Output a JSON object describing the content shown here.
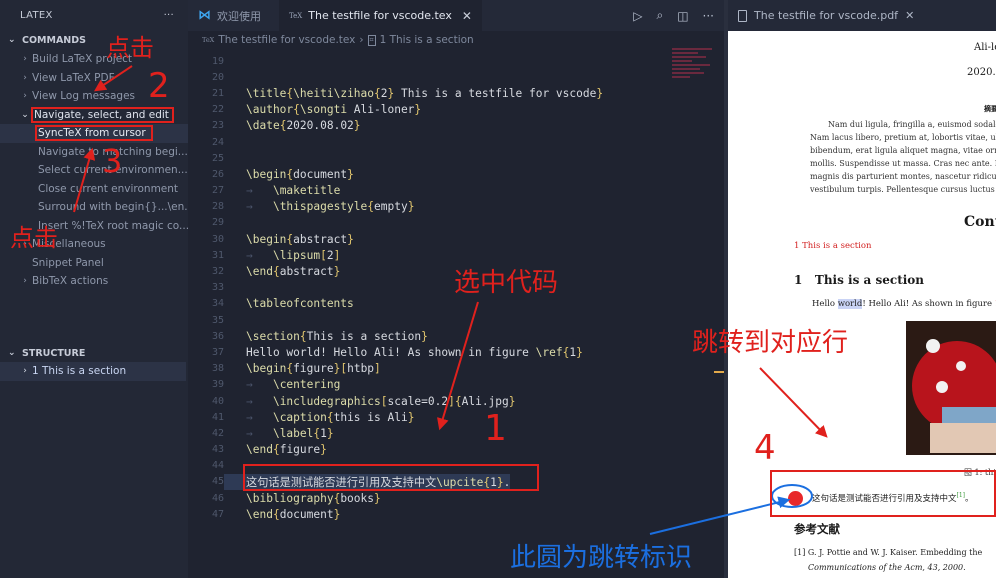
{
  "sidebar": {
    "title": "LATEX",
    "more": "···",
    "commands_header": "COMMANDS",
    "items": [
      {
        "label": "Build LaTeX project",
        "chev": "›"
      },
      {
        "label": "View LaTeX PDF",
        "chev": "›"
      },
      {
        "label": "View Log messages",
        "chev": "›"
      },
      {
        "label": "Navigate, select, and edit",
        "chev": "⌄"
      }
    ],
    "sub_items": [
      "SyncTeX from cursor",
      "Navigate to matching begi...",
      "Select current environmen...",
      "Close current environment",
      "Surround with begin{}...\\en...",
      "Insert %!TeX root magic co..."
    ],
    "leaf_items": [
      {
        "label": "Miscellaneous",
        "chev": "›"
      },
      {
        "label": "Snippet Panel",
        "chev": ""
      },
      {
        "label": "BibTeX actions",
        "chev": "›"
      }
    ],
    "structure_header": "STRUCTURE",
    "structure_item": "1 This is a section"
  },
  "editor": {
    "tabs": [
      {
        "label": "欢迎使用",
        "icon": "vscode-icon"
      },
      {
        "label": "The testfile for vscode.tex",
        "icon": "tex-icon"
      }
    ],
    "close": "✕",
    "breadcrumb": {
      "tex": "TeX",
      "file": "The testfile for vscode.tex",
      "sep": "›",
      "section": "1 This is a section"
    },
    "lines": [
      {
        "n": "19",
        "text": ""
      },
      {
        "n": "20",
        "text": ""
      },
      {
        "n": "21",
        "text": "\\title{\\heiti\\zihao{2} This is a testfile for vscode}"
      },
      {
        "n": "22",
        "text": "\\author{\\songti Ali-loner}"
      },
      {
        "n": "23",
        "text": "\\date{2020.08.02}"
      },
      {
        "n": "24",
        "text": ""
      },
      {
        "n": "25",
        "text": ""
      },
      {
        "n": "26",
        "text": "\\begin{document}"
      },
      {
        "n": "27",
        "text": "\\maketitle",
        "indent": true
      },
      {
        "n": "28",
        "text": "\\thispagestyle{empty}",
        "indent": true
      },
      {
        "n": "29",
        "text": ""
      },
      {
        "n": "30",
        "text": "\\begin{abstract}"
      },
      {
        "n": "31",
        "text": "\\lipsum[2]",
        "indent": true
      },
      {
        "n": "32",
        "text": "\\end{abstract}"
      },
      {
        "n": "33",
        "text": ""
      },
      {
        "n": "34",
        "text": "\\tableofcontents"
      },
      {
        "n": "35",
        "text": ""
      },
      {
        "n": "36",
        "text": "\\section{This is a section}"
      },
      {
        "n": "37",
        "text": "Hello world! Hello Ali! As shown in figure \\ref{1}"
      },
      {
        "n": "38",
        "text": "\\begin{figure}[htbp]"
      },
      {
        "n": "39",
        "text": "\\centering",
        "indent": true
      },
      {
        "n": "40",
        "text": "\\includegraphics[scale=0.2]{Ali.jpg}",
        "indent": true
      },
      {
        "n": "41",
        "text": "\\caption{this is Ali}",
        "indent": true
      },
      {
        "n": "42",
        "text": "\\label{1}",
        "indent": true
      },
      {
        "n": "43",
        "text": "\\end{figure}"
      },
      {
        "n": "44",
        "text": ""
      },
      {
        "n": "45",
        "text": "这句话是测试能否进行引用及支持中文\\upcite{1}.",
        "selected": true
      },
      {
        "n": "46",
        "text": "\\bibliography{books}"
      },
      {
        "n": "47",
        "text": "\\end{document}"
      }
    ]
  },
  "pdf": {
    "tab_label": "The testfile for vscode.pdf",
    "author": "Ali-lo",
    "date": "2020.0",
    "abstract_title": "摘要",
    "abstract_lines": [
      "Nam dui ligula, fringilla a, euismod sodales, soll",
      "Nam lacus libero, pretium at, lobortis vitae, ultric",
      "bibendum, erat ligula aliquet magna, vitae ornare o",
      "mollis. Suspendisse ut massa. Cras nec ante. Pellen",
      "magnis dis parturient montes, nascetur ridiculus m",
      "vestibulum turpis. Pellentesque cursus luctus maur"
    ],
    "contents_title": "Conte",
    "toc_entry": "1   This is a section",
    "section_num": "1",
    "section_title": "This is a section",
    "hello_pre": "Hello ",
    "hello_world": "world",
    "hello_post": "! Hello Ali! As shown in figure ",
    "hello_ref": "1",
    "figure_caption": "图 1: thi",
    "cn_sentence": "这句话是测试能否进行引用及支持中文",
    "cn_cite": "[1]",
    "cn_end": "。",
    "refs_title": "参考文献",
    "ref1_line1": "[1]  G. J. Pottie and W. J. Kaiser.  Embedding the",
    "ref1_line2": "Communications of the Acm, 43, 2000."
  },
  "annotations": {
    "click_top": "点击",
    "click_bottom": "点击",
    "num_1": "1",
    "num_2": "2",
    "num_3": "3",
    "num_4": "4",
    "select_code": "选中代码",
    "jump_line": "跳转到对应行",
    "circle_note": "此圆为跳转标识"
  },
  "colors": {
    "annotation_red": "#e0211d",
    "annotation_blue": "#1b6fe0",
    "sync_circle": "#e8282a"
  }
}
